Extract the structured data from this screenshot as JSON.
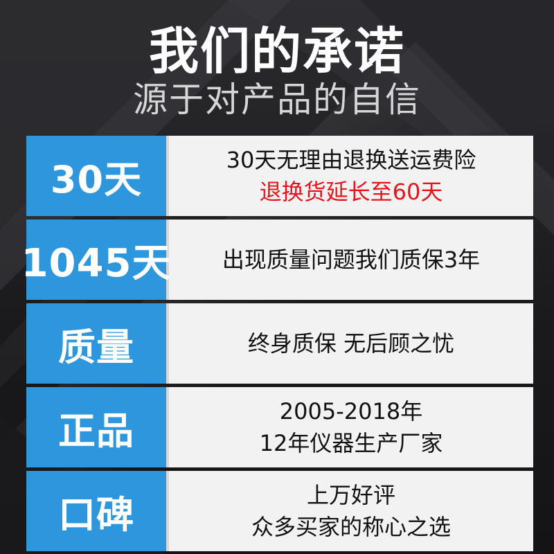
{
  "header": {
    "title": "我们的承诺",
    "subtitle": "源于对产品的自信"
  },
  "colors": {
    "label_bg": "#2e96dc",
    "content_bg": "#f2f2f2",
    "highlight_text": "#e8141c",
    "background": "#1c1c1e"
  },
  "rows": [
    {
      "label": "30天",
      "lines": [
        "30天无理由退换送运费险",
        "退换货延长至60天"
      ]
    },
    {
      "label": "1045天",
      "lines": [
        "出现质量问题我们质保3年"
      ]
    },
    {
      "label": "质量",
      "lines": [
        "终身质保 无后顾之忧"
      ]
    },
    {
      "label": "正品",
      "lines": [
        "2005-2018年",
        "12年仪器生产厂家"
      ]
    },
    {
      "label": "口碑",
      "lines": [
        "上万好评",
        "众多买家的称心之选"
      ]
    }
  ]
}
